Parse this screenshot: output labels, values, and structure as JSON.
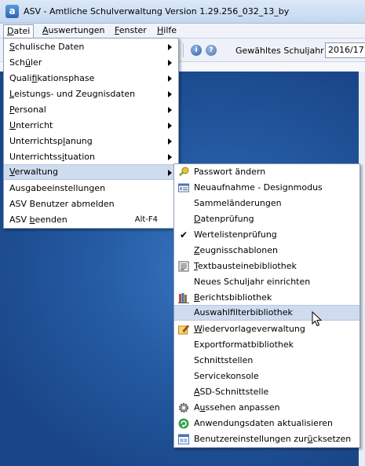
{
  "window": {
    "title": "ASV - Amtliche Schulverwaltung Version 1.29.256_032_13_by"
  },
  "menubar": {
    "datei": {
      "ul": "D",
      "rest": "atei"
    },
    "auswertungen": {
      "ul": "A",
      "rest": "uswertungen"
    },
    "fenster": {
      "ul": "F",
      "rest": "enster"
    },
    "hilfe": {
      "ul": "H",
      "rest": "ilfe"
    }
  },
  "toolbar": {
    "year_label": "Gewähltes Schuljahr",
    "year_value": "2016/17"
  },
  "datei_menu": {
    "items": [
      {
        "ul": "S",
        "rest": "chulische Daten"
      },
      {
        "pre": "Sch",
        "ul": "ü",
        "rest": "ler"
      },
      {
        "pre": "Quali",
        "ul": "f",
        "rest": "ikationsphase"
      },
      {
        "ul": "L",
        "rest": "eistungs- und Zeugnisdaten"
      },
      {
        "ul": "P",
        "rest": "ersonal"
      },
      {
        "ul": "U",
        "rest": "nterricht"
      },
      {
        "pre": "Unterrichtsp",
        "ul": "l",
        "rest": "anung"
      },
      {
        "pre": "Unterrichtss",
        "ul": "i",
        "rest": "tuation"
      },
      {
        "ul": "V",
        "rest": "erwaltung"
      },
      {
        "label": "Ausgabeeinstellungen"
      },
      {
        "label": "ASV Benutzer abmelden"
      },
      {
        "pre": "ASV ",
        "ul": "b",
        "rest": "eenden",
        "shortcut": "Alt-F4"
      }
    ]
  },
  "verwaltung_menu": {
    "items": [
      {
        "label": "Passwort ändern",
        "icon": "key-icon"
      },
      {
        "label": "Neuaufnahme - Designmodus",
        "icon": "form-icon"
      },
      {
        "label": "Sammeländerungen"
      },
      {
        "ul": "D",
        "rest": "atenprüfung"
      },
      {
        "label": "Wertelistenprüfung",
        "icon": "checkmark-icon"
      },
      {
        "ul": "Z",
        "rest": "eugnisschablonen"
      },
      {
        "ul": "T",
        "rest": "extbausteinebibliothek",
        "icon": "text-lines-icon"
      },
      {
        "label": "Neues Schuljahr einrichten"
      },
      {
        "ul": "B",
        "rest": "erichtsbibliothek",
        "icon": "books-icon"
      },
      {
        "label": "Auswahlfilterbibliothek"
      },
      {
        "ul": "W",
        "rest": "iedervorlageverwaltung",
        "icon": "pencil-icon"
      },
      {
        "label": "Exportformatbibliothek"
      },
      {
        "label": "Schnittstellen"
      },
      {
        "label": "Servicekonsole"
      },
      {
        "ul": "A",
        "rest": "SD-Schnittstelle"
      },
      {
        "pre": "A",
        "ul": "u",
        "rest": "ssehen anpassen",
        "icon": "gear-icon"
      },
      {
        "label": "Anwendungsdaten aktualisieren",
        "icon": "refresh-icon"
      },
      {
        "pre": "Benutzereinstellungen zur",
        "ul": "ü",
        "rest": "cksetzen",
        "icon": "user-settings-icon"
      }
    ]
  },
  "colors": {
    "desktop": "#245ba3",
    "highlight": "#cfdcef"
  }
}
